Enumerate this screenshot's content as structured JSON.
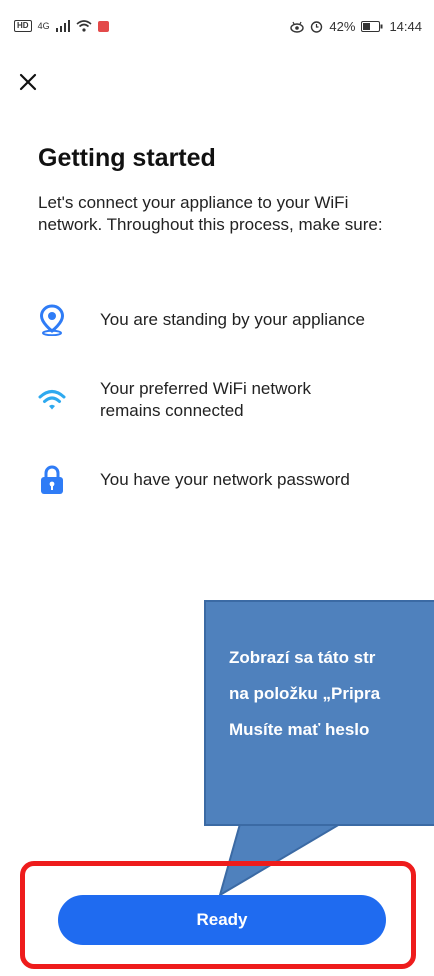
{
  "status_bar": {
    "network": "4G",
    "battery_percent": "42%",
    "time": "14:44",
    "hd_badge": "HD"
  },
  "header": {
    "close_icon": "close-icon"
  },
  "main": {
    "title": "Getting started",
    "intro": "Let's connect your appliance to your WiFi network. Throughout this process, make sure:",
    "requirements": [
      {
        "icon": "location-pin-icon",
        "text": "You are standing by your appliance"
      },
      {
        "icon": "wifi-icon",
        "text": "Your preferred WiFi network remains connected"
      },
      {
        "icon": "lock-icon",
        "text": "You have your network password"
      }
    ]
  },
  "callout": {
    "lines": [
      "Zobrazí sa táto str",
      "na položku „Pripra",
      "Musíte mať heslo"
    ]
  },
  "footer": {
    "ready_label": "Ready"
  },
  "colors": {
    "accent": "#1f6bf0",
    "callout_bg": "#4f81bd",
    "highlight": "#ee1c1c"
  }
}
